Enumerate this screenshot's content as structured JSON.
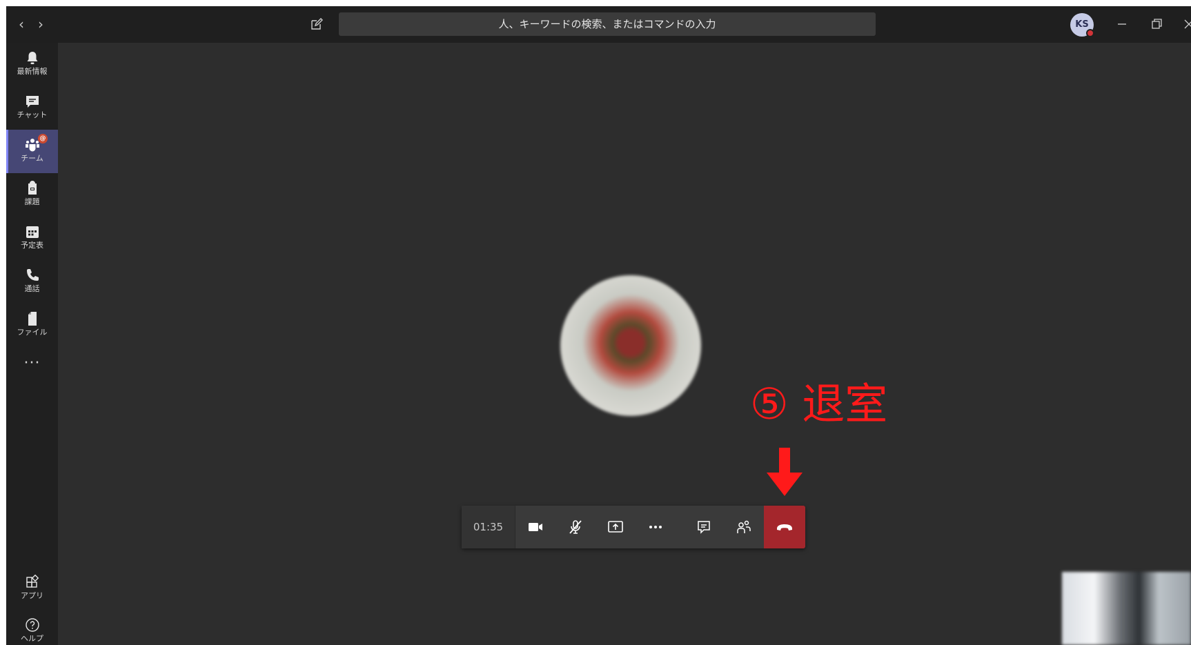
{
  "titlebar": {
    "search_placeholder": "人、キーワードの検索、またはコマンドの入力",
    "avatar_initials": "KS",
    "avatar_status_color": "#d13438"
  },
  "appbar": {
    "items": [
      {
        "label": "最新情報",
        "icon": "bell-icon"
      },
      {
        "label": "チャット",
        "icon": "chat-icon"
      },
      {
        "label": "チーム",
        "icon": "teams-icon",
        "active": true,
        "badge": "@"
      },
      {
        "label": "課題",
        "icon": "assignments-icon"
      },
      {
        "label": "予定表",
        "icon": "calendar-icon"
      },
      {
        "label": "通話",
        "icon": "phone-icon"
      },
      {
        "label": "ファイル",
        "icon": "file-icon"
      }
    ],
    "more": "···",
    "bottom_items": [
      {
        "label": "アプリ",
        "icon": "apps-icon"
      },
      {
        "label": "ヘルプ",
        "icon": "help-icon"
      }
    ]
  },
  "call": {
    "timer": "01:35",
    "controls": [
      "camera-icon",
      "mic-muted-icon",
      "share-screen-icon",
      "more-icon",
      "chat-icon",
      "participants-icon",
      "hangup-icon"
    ]
  },
  "annotation": {
    "text": "⑤ 退室",
    "color": "#ff1a1a"
  },
  "colors": {
    "stage_bg": "#2d2d2d",
    "titlebar_bg": "#1f1f1f",
    "appbar_bg": "#202020",
    "active_bg": "#464775",
    "hangup_bg": "#a4262c"
  }
}
